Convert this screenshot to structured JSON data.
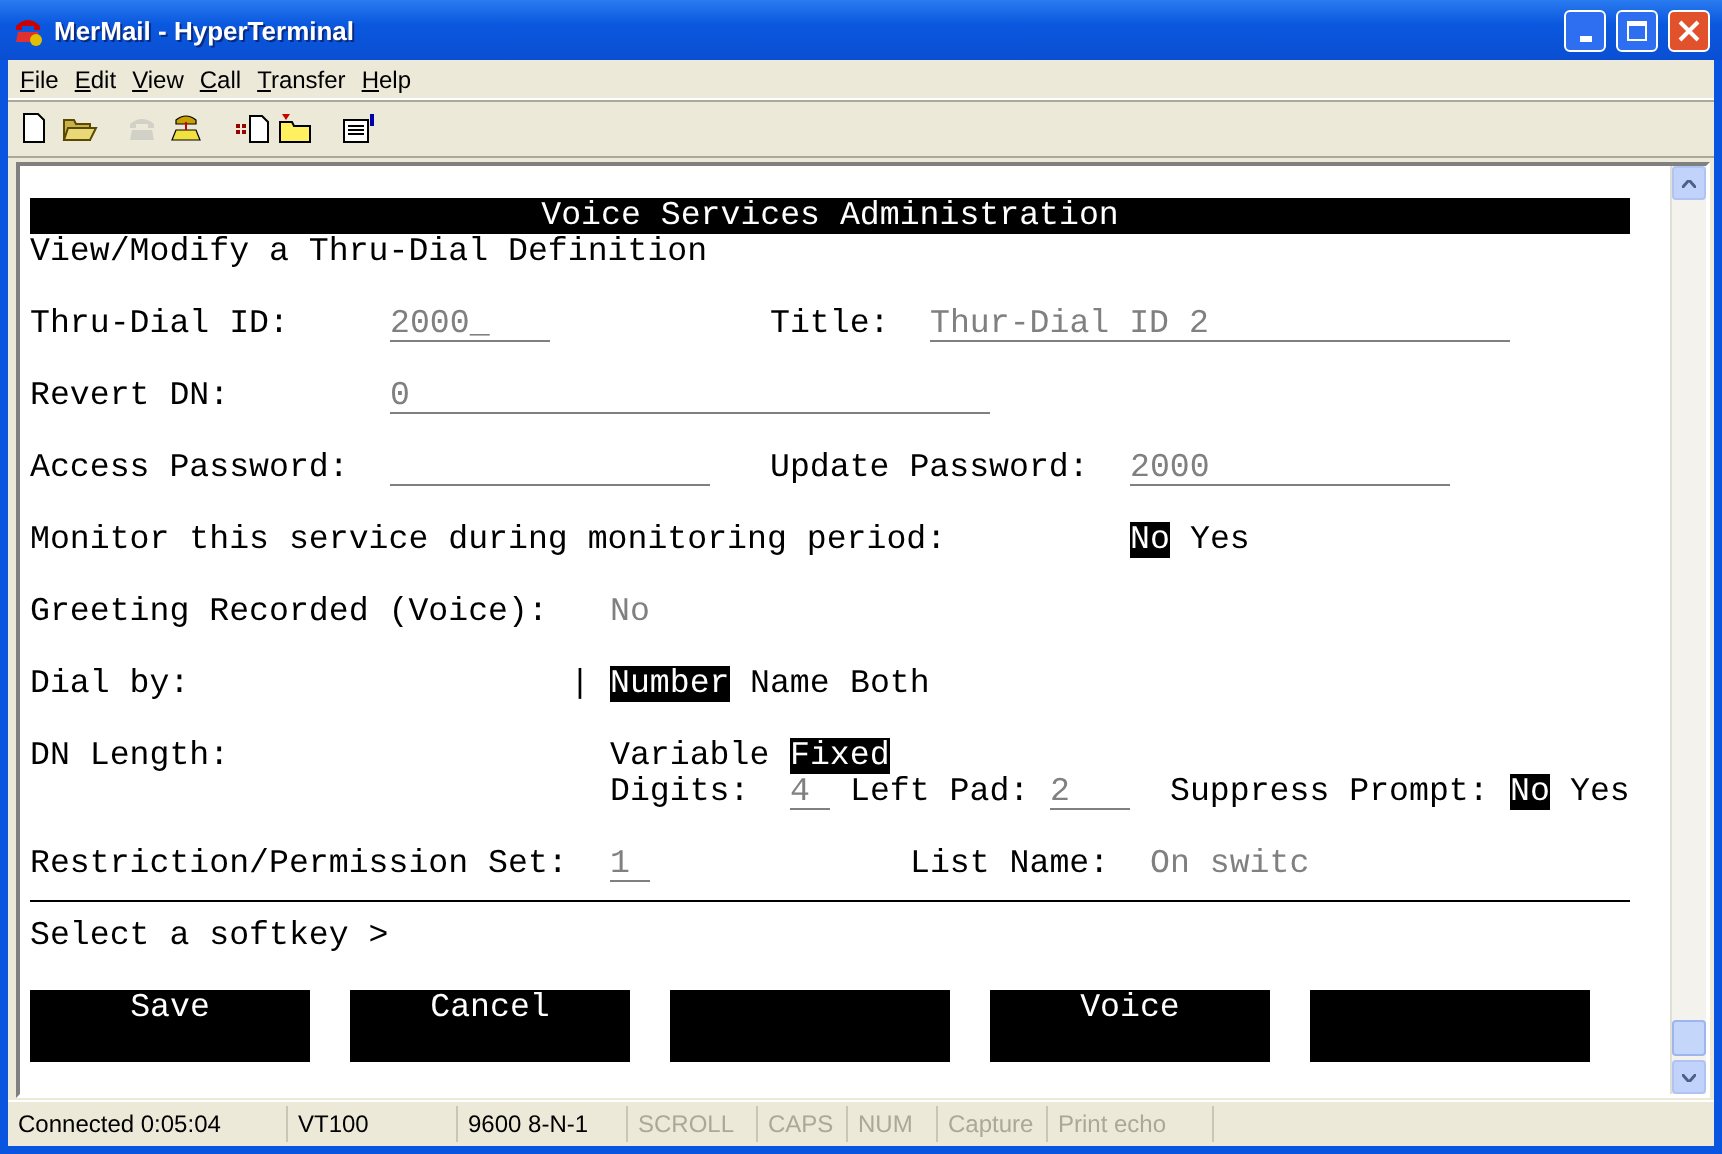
{
  "window": {
    "title": "MerMail - HyperTerminal"
  },
  "menu": [
    {
      "label": "File"
    },
    {
      "label": "Edit"
    },
    {
      "label": "View"
    },
    {
      "label": "Call"
    },
    {
      "label": "Transfer"
    },
    {
      "label": "Help"
    }
  ],
  "toolbar": [
    {
      "kind": "new",
      "disabled": false
    },
    {
      "kind": "open",
      "disabled": false
    },
    {
      "kind": "phone",
      "disabled": true
    },
    {
      "kind": "dial",
      "disabled": false
    },
    {
      "kind": "send",
      "disabled": false
    },
    {
      "kind": "receive",
      "disabled": false
    },
    {
      "kind": "properties",
      "disabled": false
    }
  ],
  "terminal": {
    "header": "Voice Services Administration",
    "subtitle": "View/Modify a Thru-Dial Definition",
    "lines": [
      [
        {
          "kind": "label",
          "text": "Thru-Dial ID:"
        },
        {
          "kind": "field",
          "value": "2000_"
        },
        {
          "kind": "label",
          "text": "Title:"
        },
        {
          "kind": "field",
          "value": "Thur-Dial ID 2"
        }
      ],
      [
        {
          "kind": "label",
          "text": "Revert DN:"
        },
        {
          "kind": "field",
          "value": "0"
        }
      ],
      [
        {
          "kind": "label",
          "text": "Access Password:"
        },
        {
          "kind": "field"
        },
        {
          "kind": "label",
          "text": "Update Password:"
        },
        {
          "kind": "field",
          "value": "2000"
        }
      ],
      [
        {
          "kind": "label",
          "text": "Monitor this service during monitoring period:"
        },
        {
          "kind": "option",
          "text": "No",
          "selected": true
        },
        {
          "kind": "option",
          "text": "Yes",
          "selected": false
        }
      ],
      [
        {
          "kind": "label",
          "text": "Greeting Recorded (Voice):"
        },
        {
          "kind": "readonly",
          "text": "No"
        }
      ],
      [
        {
          "kind": "label",
          "text": "Dial by:"
        },
        {
          "kind": "cursor",
          "text": "|"
        },
        {
          "kind": "option",
          "text": "Number",
          "selected": true
        },
        {
          "kind": "option",
          "text": "Name",
          "selected": false
        },
        {
          "kind": "option",
          "text": "Both",
          "selected": false
        }
      ],
      [
        {
          "kind": "label",
          "text": "DN Length:"
        },
        {
          "kind": "option",
          "text": "Variable",
          "selected": false
        },
        {
          "kind": "option",
          "text": "Fixed",
          "selected": true
        }
      ],
      [
        {
          "kind": "label",
          "text": "Digits:"
        },
        {
          "kind": "field",
          "value": "4"
        },
        {
          "kind": "label",
          "text": "Left Pad:"
        },
        {
          "kind": "field",
          "value": "2"
        },
        {
          "kind": "label",
          "text": "Suppress Prompt:"
        },
        {
          "kind": "option",
          "text": "No",
          "selected": true
        },
        {
          "kind": "option",
          "text": "Yes",
          "selected": false
        }
      ],
      [
        {
          "kind": "label",
          "text": "Restriction/Permission Set:"
        },
        {
          "kind": "field",
          "value": "1"
        },
        {
          "kind": "label",
          "text": "List Name:"
        },
        {
          "kind": "readonly",
          "text": "On switc"
        }
      ]
    ],
    "prompt": "Select a softkey >",
    "softkeys": [
      {
        "kind": "labeled",
        "label": "Save"
      },
      {
        "kind": "labeled",
        "label": "Cancel"
      },
      {
        "kind": "blank"
      },
      {
        "kind": "labeled",
        "label": "Voice"
      },
      {
        "kind": "blank"
      }
    ]
  },
  "status_bar": [
    {
      "text": "Connected 0:05:04",
      "disabled": false
    },
    {
      "text": "VT100",
      "disabled": false
    },
    {
      "text": "9600 8-N-1",
      "disabled": false
    },
    {
      "text": "SCROLL",
      "disabled": true
    },
    {
      "text": "CAPS",
      "disabled": true
    },
    {
      "text": "NUM",
      "disabled": true
    },
    {
      "text": "Capture",
      "disabled": true
    },
    {
      "text": "Print echo",
      "disabled": true
    }
  ]
}
